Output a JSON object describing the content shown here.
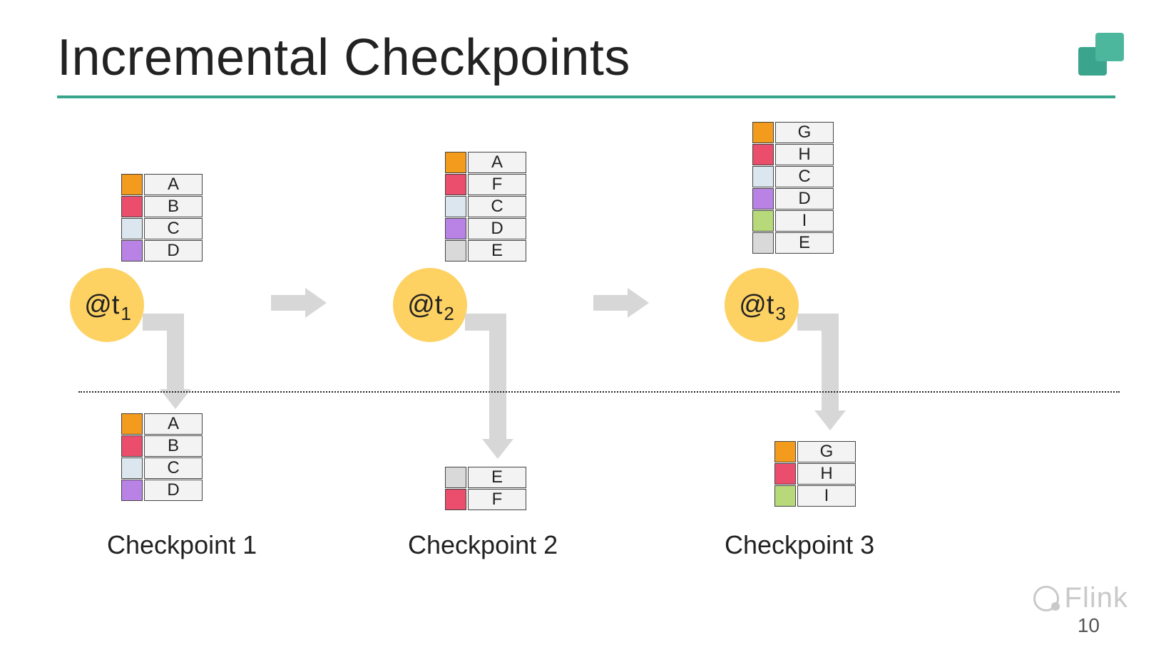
{
  "title": "Incremental Checkpoints",
  "page_number": "10",
  "watermark": "Flink",
  "timepoints": {
    "t1": {
      "label": "@t",
      "sub": "1"
    },
    "t2": {
      "label": "@t",
      "sub": "2"
    },
    "t3": {
      "label": "@t",
      "sub": "3"
    }
  },
  "state": {
    "t1": [
      {
        "color": "orange",
        "label": "A"
      },
      {
        "color": "pink",
        "label": "B"
      },
      {
        "color": "blue",
        "label": "C"
      },
      {
        "color": "purple",
        "label": "D"
      }
    ],
    "t2": [
      {
        "color": "orange",
        "label": "A"
      },
      {
        "color": "pink",
        "label": "F"
      },
      {
        "color": "blue",
        "label": "C"
      },
      {
        "color": "purple",
        "label": "D"
      },
      {
        "color": "gray",
        "label": "E"
      }
    ],
    "t3": [
      {
        "color": "orange",
        "label": "G"
      },
      {
        "color": "pink",
        "label": "H"
      },
      {
        "color": "blue",
        "label": "C"
      },
      {
        "color": "purple",
        "label": "D"
      },
      {
        "color": "green",
        "label": "I"
      },
      {
        "color": "gray",
        "label": "E"
      }
    ]
  },
  "checkpoints": {
    "cp1": {
      "caption": "Checkpoint 1",
      "rows": [
        {
          "color": "orange",
          "label": "A"
        },
        {
          "color": "pink",
          "label": "B"
        },
        {
          "color": "blue",
          "label": "C"
        },
        {
          "color": "purple",
          "label": "D"
        }
      ]
    },
    "cp2": {
      "caption": "Checkpoint 2",
      "rows": [
        {
          "color": "gray",
          "label": "E"
        },
        {
          "color": "pink",
          "label": "F"
        }
      ]
    },
    "cp3": {
      "caption": "Checkpoint 3",
      "rows": [
        {
          "color": "orange",
          "label": "G"
        },
        {
          "color": "pink",
          "label": "H"
        },
        {
          "color": "green",
          "label": "I"
        }
      ]
    }
  }
}
